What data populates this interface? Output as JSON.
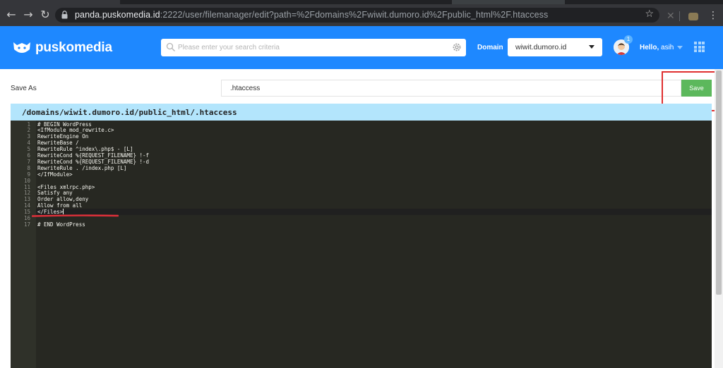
{
  "browser": {
    "url_host": "panda.puskomedia.id",
    "url_rest": ":2222/user/filemanager/edit?path=%2Fdomains%2Fwiwit.dumoro.id%2Fpublic_html%2F.htaccess",
    "icons": [
      "back-icon",
      "forward-icon",
      "reload-icon",
      "lock-icon",
      "star-icon",
      "menu-icon"
    ]
  },
  "header": {
    "logo_text": "puskomedia",
    "search_placeholder": "Please enter your search criteria",
    "domain_label": "Domain",
    "domain_value": "wiwit.dumoro.id",
    "notification_count": "1",
    "greeting_prefix": "Hello,",
    "greeting_user": "asih",
    "brand_color": "#1e88ff"
  },
  "save_row": {
    "label": "Save As",
    "filename": ".htaccess",
    "save_label": "Save",
    "save_color": "#5cb85c"
  },
  "editor": {
    "path": "/domains/wiwit.dumoro.id/public_html/.htaccess",
    "lines": [
      "# BEGIN WordPress",
      "<IfModule mod_rewrite.c>",
      "RewriteEngine On",
      "RewriteBase /",
      "RewriteRule ^index\\.php$ - [L]",
      "RewriteCond %{REQUEST_FILENAME} !-f",
      "RewriteCond %{REQUEST_FILENAME} !-d",
      "RewriteRule . /index.php [L]",
      "</IfModule>",
      "",
      "<Files xmlrpc.php>",
      "Satisfy any",
      "Order allow,deny",
      "Allow from all",
      "</Files>",
      "",
      "# END WordPress"
    ],
    "active_line": 15,
    "theme_bg": "#272822"
  }
}
